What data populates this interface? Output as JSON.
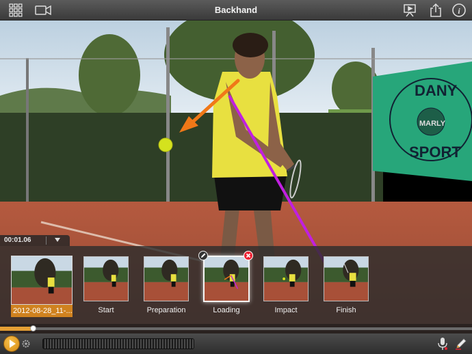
{
  "window": {
    "title": "Backhand"
  },
  "toolbar": {
    "left_icons": [
      "grid-icon",
      "video-camera-icon"
    ],
    "right_icons": [
      "present-icon",
      "share-icon",
      "info-icon"
    ]
  },
  "player": {
    "timecode": "00:01.06",
    "progress_fraction": 0.07
  },
  "filmstrip": {
    "first_clip_label": "2012-08-28_11-...",
    "frames": [
      {
        "label": "Start"
      },
      {
        "label": "Preparation"
      },
      {
        "label": "Loading",
        "selected": true
      },
      {
        "label": "Impact"
      },
      {
        "label": "Finish"
      }
    ]
  },
  "scene_text": {
    "banner_line1": "DANY",
    "banner_line2": "MARLY",
    "banner_line3": "SPORT"
  },
  "colors": {
    "accent_orange": "#e6a035",
    "arrow_orange": "#f07818",
    "line_purple": "#c020e0",
    "shirt_yellow": "#e8e040",
    "banner_green": "#27a67a",
    "court_clay": "#a85038",
    "delete_red": "#e22233"
  },
  "bottombar": {
    "icons": [
      "play-icon",
      "gear-icon",
      "microphone-icon",
      "pen-icon"
    ]
  }
}
